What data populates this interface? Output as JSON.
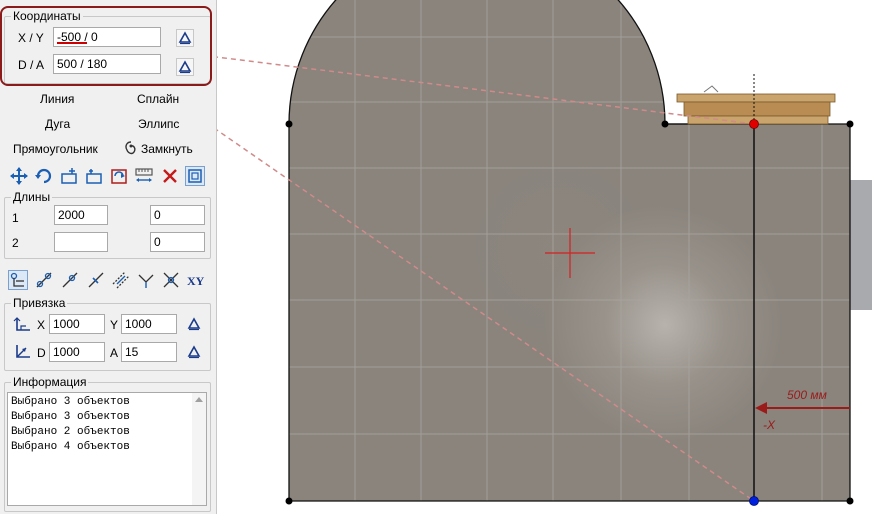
{
  "coords": {
    "title": "Координаты",
    "xy_label": "X / Y",
    "xy_value": "-500 / 0",
    "da_label": "D / A",
    "da_value": "500 / 180"
  },
  "tools": {
    "line": "Линия",
    "spline": "Сплайн",
    "arc": "Дуга",
    "ellipse": "Эллипс",
    "rectangle": "Прямоугольник",
    "close": "Замкнуть"
  },
  "lengths": {
    "title": "Длины",
    "rows": [
      {
        "index": "1",
        "length": "2000",
        "value": "0"
      },
      {
        "index": "2",
        "length": "",
        "value": "0"
      }
    ]
  },
  "snap": {
    "title": "Привязка",
    "x_label": "X",
    "x_value": "1000",
    "y_label": "Y",
    "y_value": "1000",
    "d_label": "D",
    "d_value": "1000",
    "a_label": "A",
    "a_value": "15"
  },
  "info": {
    "title": "Информация",
    "lines": [
      "Выбрано 3 объектов",
      "Выбрано 3 объектов",
      "Выбрано 2 объектов",
      "Выбрано 4 объектов"
    ]
  },
  "canvas": {
    "dimension_label": "500 мм",
    "axis_label": "-X"
  },
  "colors": {
    "highlight_border": "#8b1a1a",
    "wall": "#8a847d",
    "dashed_pointer": "#d08a8a",
    "point_red": "#e00000",
    "point_blue": "#0020e0",
    "annotation": "#9b1b1b"
  }
}
